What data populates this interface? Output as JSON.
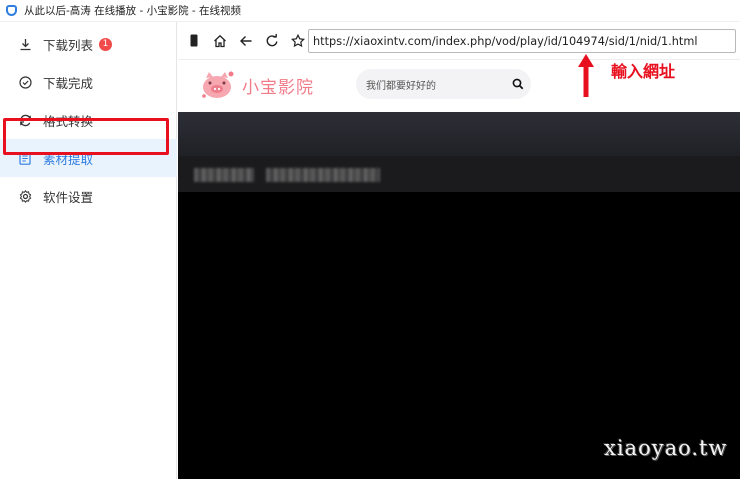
{
  "window": {
    "title": "从此以后-高涛 在线播放 - 小宝影院 - 在线视频"
  },
  "sidebar": {
    "items": [
      {
        "label": "下载列表",
        "icon": "download-icon",
        "badge": "1",
        "active": false
      },
      {
        "label": "下载完成",
        "icon": "check-circle-icon",
        "active": false
      },
      {
        "label": "格式转换",
        "icon": "refresh-icon",
        "active": false
      },
      {
        "label": "素材提取",
        "icon": "document-icon",
        "active": true
      },
      {
        "label": "软件设置",
        "icon": "gear-icon",
        "active": false
      }
    ]
  },
  "browser": {
    "url": "https://xiaoxintv.com/index.php/vod/play/id/104974/sid/1/nid/1.html"
  },
  "site": {
    "logo_text": "小宝影院",
    "search_placeholder": "我们都要好好的"
  },
  "annotation": {
    "text": "輸入網址"
  },
  "watermark": "xiaoyao.tw",
  "colors": {
    "accent": "#2f7de1",
    "highlight_red": "#e8101e",
    "logo_pink": "#f27b89",
    "badge_red": "#f04a4a",
    "player_bg": "#000000"
  }
}
